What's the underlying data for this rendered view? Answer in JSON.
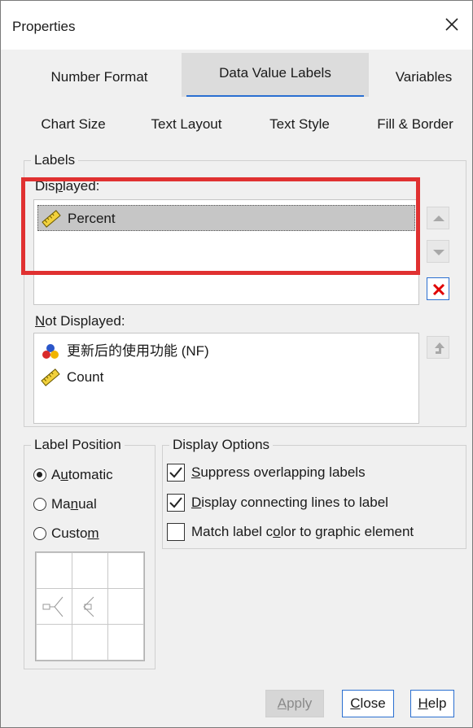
{
  "window": {
    "title": "Properties"
  },
  "tabs_row1": [
    {
      "label": "Number Format"
    },
    {
      "label": "Data Value Labels",
      "active": true
    },
    {
      "label": "Variables"
    }
  ],
  "tabs_row2": [
    {
      "label": "Chart Size"
    },
    {
      "label": "Text Layout"
    },
    {
      "label": "Text Style"
    },
    {
      "label": "Fill & Border"
    }
  ],
  "labels_group": {
    "legend": "Labels",
    "displayed_label_pre": "Dis",
    "displayed_label_u": "p",
    "displayed_label_post": "layed:",
    "displayed_items": [
      {
        "label": "Percent",
        "icon": "ruler-icon",
        "selected": true
      }
    ],
    "not_displayed_label_u": "N",
    "not_displayed_label_post": "ot Displayed:",
    "not_displayed_items": [
      {
        "label": "更新后的使用功能 (NF)",
        "icon": "nominal-variable-icon"
      },
      {
        "label": "Count",
        "icon": "ruler-icon"
      }
    ]
  },
  "label_position": {
    "legend": "Label Position",
    "options": [
      {
        "pre": "A",
        "u": "u",
        "post": "tomatic",
        "checked": true
      },
      {
        "pre": "Ma",
        "u": "n",
        "post": "ual",
        "checked": false
      },
      {
        "pre": "Custo",
        "u": "m",
        "post": "",
        "checked": false
      }
    ]
  },
  "display_options": {
    "legend": "Display Options",
    "options": [
      {
        "pre": "",
        "u": "S",
        "post": "uppress overlapping labels",
        "checked": true
      },
      {
        "pre": "",
        "u": "D",
        "post": "isplay connecting lines to label",
        "checked": true
      },
      {
        "pre": "Match label c",
        "u": "o",
        "post": "lor to graphic element",
        "checked": false
      }
    ]
  },
  "buttons": {
    "apply_u": "A",
    "apply_post": "pply",
    "close_u": "C",
    "close_post": "lose",
    "help_u": "H",
    "help_post": "elp"
  },
  "colors": {
    "accent": "#2a6fd1",
    "highlight_box": "#e03131",
    "delete_red": "#e00000"
  }
}
